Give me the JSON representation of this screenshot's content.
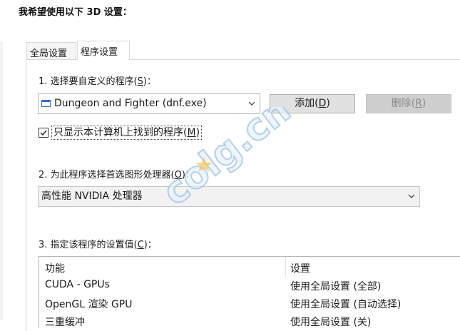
{
  "header": {
    "title": "我希望使用以下 3D 设置："
  },
  "tabs": [
    {
      "label": "全局设置",
      "active": false
    },
    {
      "label": "程序设置",
      "active": true
    }
  ],
  "section1": {
    "label_prefix": "1. 选择要自定义的程序(",
    "label_key": "S",
    "label_suffix": ")：",
    "program_value": "Dungeon and Fighter (dnf.exe)",
    "add_prefix": "添加(",
    "add_key": "D",
    "add_suffix": ")",
    "delete_prefix": "删除(",
    "delete_key": "R",
    "delete_suffix": ")",
    "checkbox_prefix": "只显示本计算机上找到的程序(",
    "checkbox_key": "M",
    "checkbox_suffix": ")",
    "checkbox_checked": true
  },
  "section2": {
    "label_prefix": "2. 为此程序选择首选图形处理器(",
    "label_key": "O",
    "label_suffix": ")：",
    "gpu_value": "高性能 NVIDIA 处理器"
  },
  "section3": {
    "label_prefix": "3. 指定该程序的设置值(",
    "label_key": "C",
    "label_suffix": ")：",
    "columns": [
      "功能",
      "设置"
    ],
    "rows": [
      {
        "feature": "CUDA - GPUs",
        "setting": "使用全局设置 (全部)"
      },
      {
        "feature": "OpenGL 渲染 GPU",
        "setting": "使用全局设置 (自动选择)"
      },
      {
        "feature": "三重缓冲",
        "setting": "使用全局设置 (关)"
      }
    ]
  },
  "watermark": {
    "text": "colg.cn"
  },
  "colors": {
    "accent": "#2c6fd1",
    "button": "#e1e1e1",
    "disabled_text": "#8a8a8a"
  }
}
